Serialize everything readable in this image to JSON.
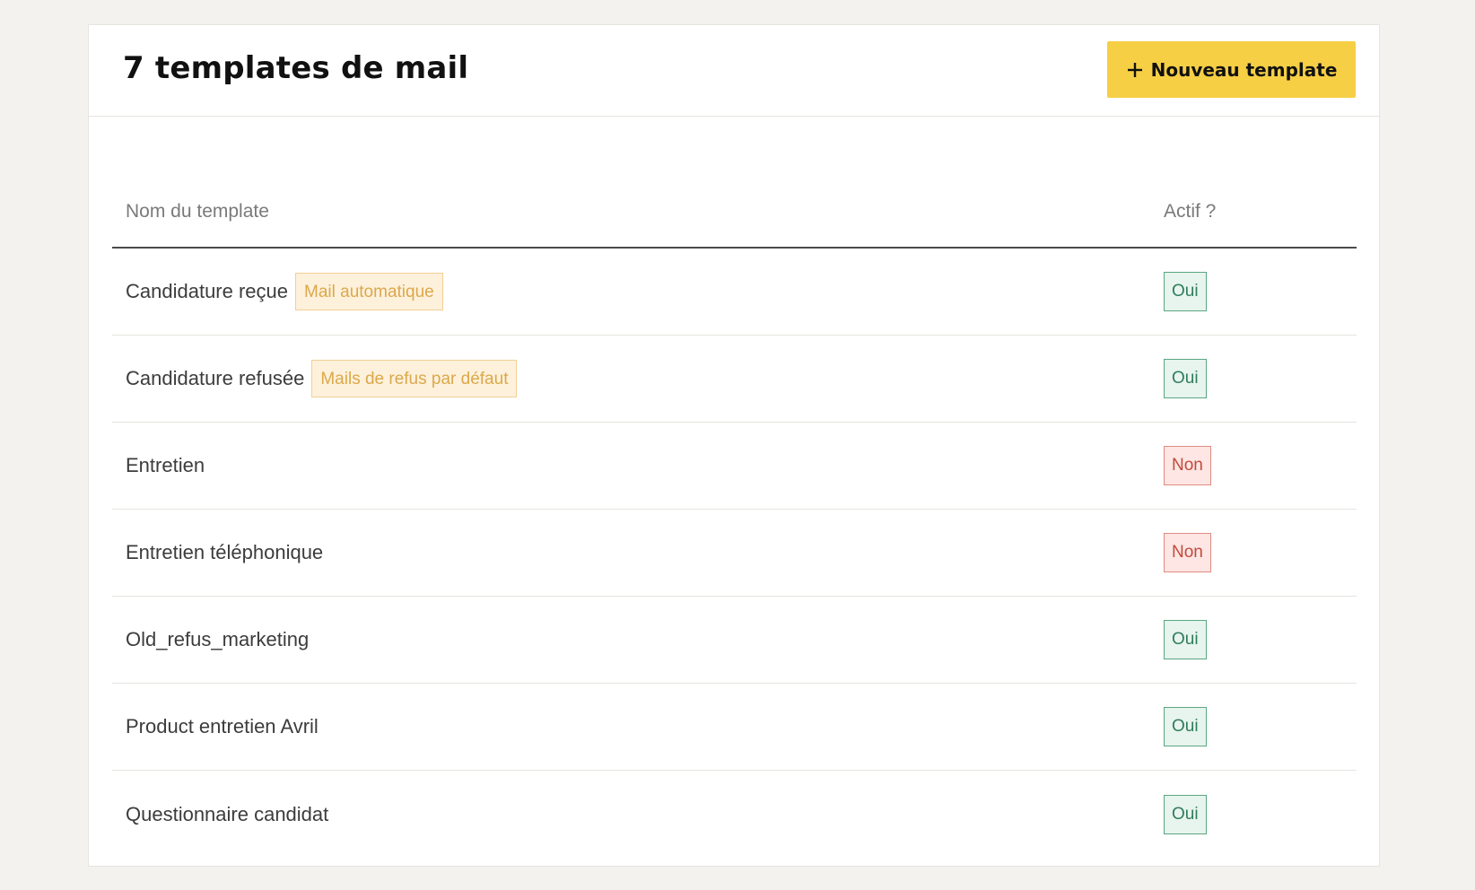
{
  "header": {
    "title": "7 templates de mail",
    "new_button_label": "Nouveau template",
    "new_button_icon": "plus-icon",
    "accent_color": "#f6cf45"
  },
  "table": {
    "columns": {
      "name": "Nom du template",
      "active": "Actif ?"
    },
    "rows": [
      {
        "name": "Candidature reçue",
        "tag": "Mail automatique",
        "active": "Oui"
      },
      {
        "name": "Candidature refusée",
        "tag": "Mails de refus par défaut",
        "active": "Oui"
      },
      {
        "name": "Entretien",
        "tag": null,
        "active": "Non"
      },
      {
        "name": "Entretien téléphonique",
        "tag": null,
        "active": "Non"
      },
      {
        "name": "Old_refus_marketing",
        "tag": null,
        "active": "Oui"
      },
      {
        "name": "Product entretien Avril",
        "tag": null,
        "active": "Oui"
      },
      {
        "name": "Questionnaire candidat",
        "tag": null,
        "active": "Oui"
      }
    ]
  },
  "colors": {
    "active_yes": "#2f7d5a",
    "active_no": "#c24a3d",
    "tag": "#dca84a"
  }
}
